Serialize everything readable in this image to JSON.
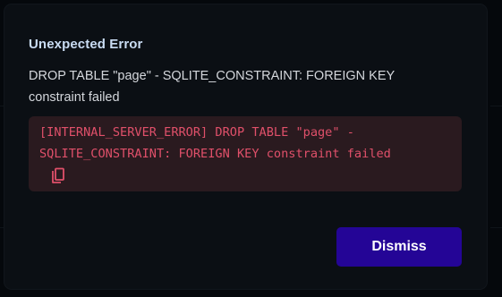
{
  "dialog": {
    "title": "Unexpected Error",
    "message": "DROP TABLE \"page\" - SQLITE_CONSTRAINT: FOREIGN KEY constraint failed",
    "error_detail": "[INTERNAL_SERVER_ERROR] DROP TABLE \"page\" - SQLITE_CONSTRAINT: FOREIGN KEY constraint failed",
    "copy_icon": "copy-icon",
    "dismiss_label": "Dismiss"
  },
  "colors": {
    "dialog_background": "#0b0f14",
    "title": "#c9dcf3",
    "error_background": "#2a1a1f",
    "error_text": "#e0506a",
    "dismiss_button": "#240596"
  }
}
